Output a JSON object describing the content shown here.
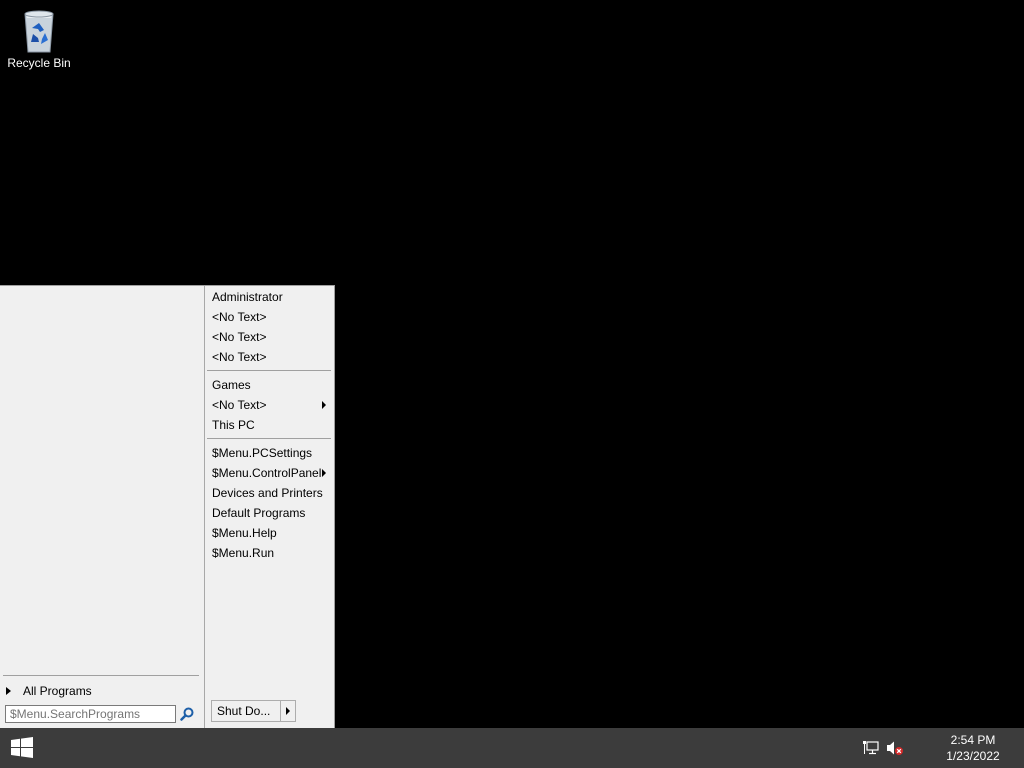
{
  "desktop": {
    "icons": [
      {
        "label": "Recycle Bin",
        "icon": "recycle-bin-icon"
      }
    ]
  },
  "start_menu": {
    "all_programs_label": "All Programs",
    "search": {
      "placeholder": "$Menu.SearchPrograms",
      "value": ""
    },
    "right_items": [
      "Administrator",
      "<No Text>",
      "<No Text>",
      "<No Text>",
      "Games",
      "<No Text>",
      "This PC",
      "$Menu.PCSettings",
      "$Menu.ControlPanel",
      "Devices and Printers",
      "Default Programs",
      "$Menu.Help",
      "$Menu.Run"
    ],
    "shutdown_label": "Shut Do..."
  },
  "taskbar": {
    "start_icon": "windows-logo-icon",
    "tray_icons": [
      "network-icon",
      "volume-muted-icon"
    ],
    "time": "2:54 PM",
    "date": "1/23/2022"
  }
}
